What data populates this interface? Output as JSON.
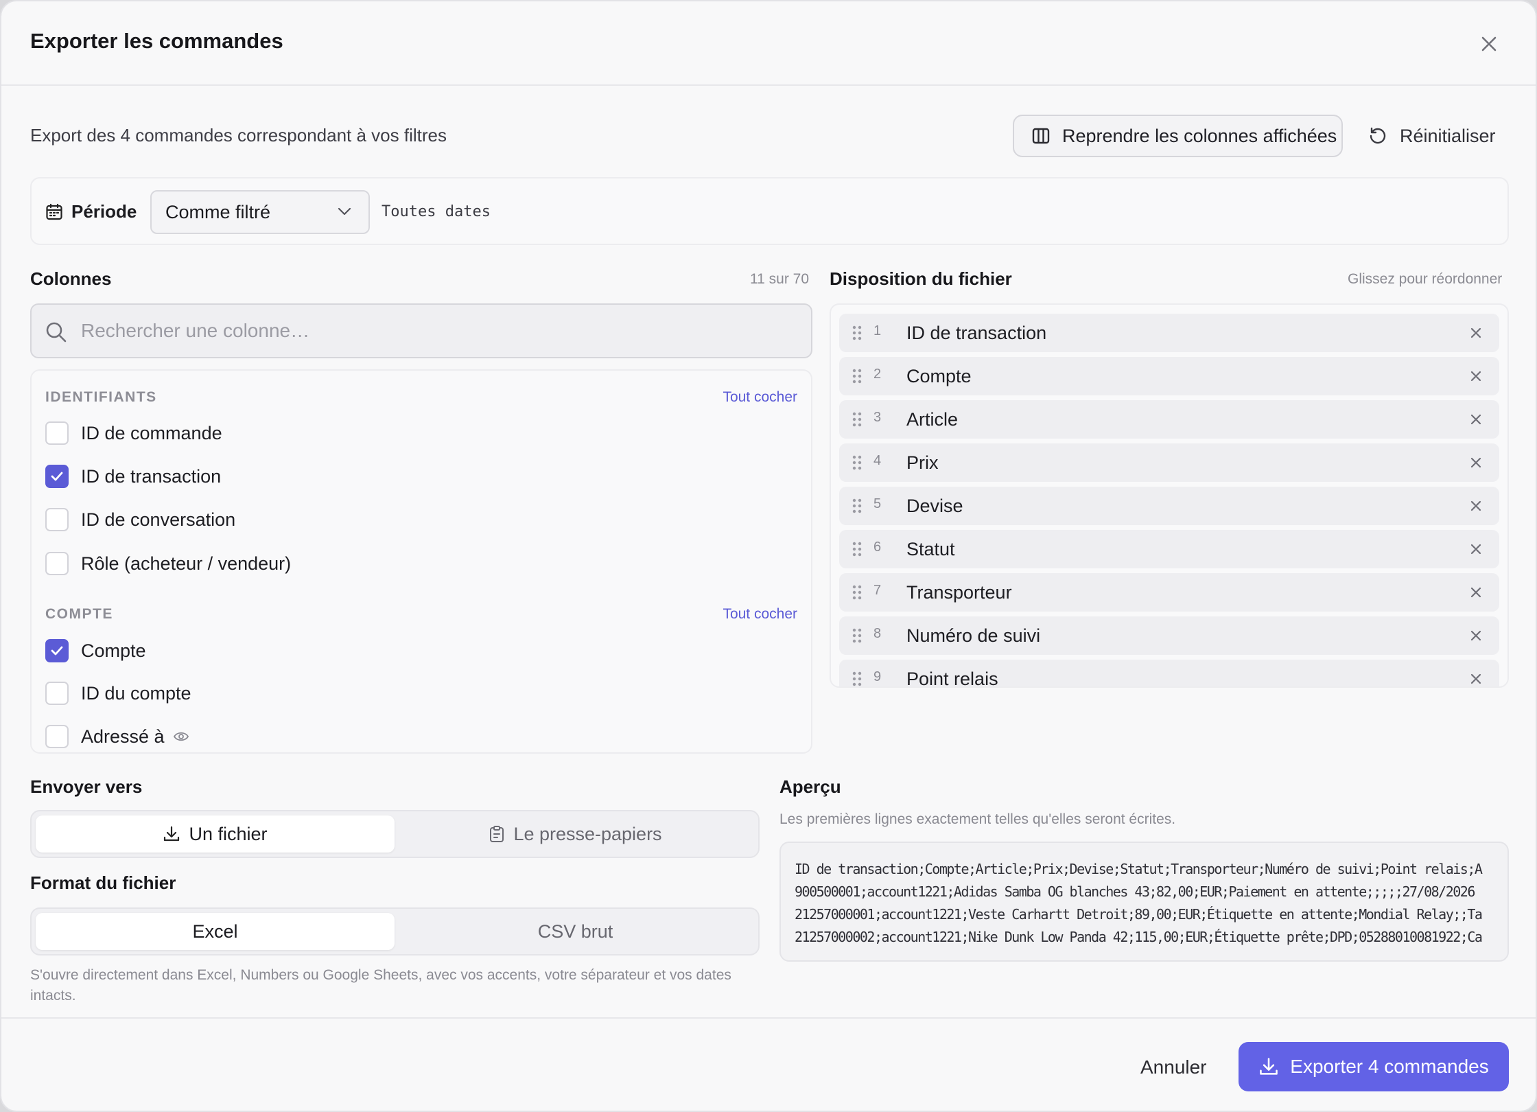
{
  "dialog": {
    "title": "Exporter les commandes",
    "subtitle": "Export des 4 commandes correspondant à vos filtres",
    "reuse_columns_label": "Reprendre les colonnes affichées",
    "reset_label": "Réinitialiser"
  },
  "period": {
    "label": "Période",
    "selected": "Comme filtré",
    "note": "Toutes dates"
  },
  "columns": {
    "title": "Colonnes",
    "count": "11 sur 70",
    "search_placeholder": "Rechercher une colonne…",
    "groups": [
      {
        "name": "IDENTIFIANTS",
        "select_all": "Tout cocher",
        "items": [
          {
            "label": "ID de commande",
            "checked": false
          },
          {
            "label": "ID de transaction",
            "checked": true
          },
          {
            "label": "ID de conversation",
            "checked": false
          },
          {
            "label": "Rôle (acheteur / vendeur)",
            "checked": false
          }
        ]
      },
      {
        "name": "COMPTE",
        "select_all": "Tout cocher",
        "items": [
          {
            "label": "Compte",
            "checked": true
          },
          {
            "label": "ID du compte",
            "checked": false
          },
          {
            "label": "Adressé à",
            "checked": false
          }
        ]
      }
    ]
  },
  "layout": {
    "title": "Disposition du fichier",
    "hint": "Glissez pour réordonner",
    "rows": [
      {
        "num": "1",
        "label": "ID de transaction"
      },
      {
        "num": "2",
        "label": "Compte"
      },
      {
        "num": "3",
        "label": "Article"
      },
      {
        "num": "4",
        "label": "Prix"
      },
      {
        "num": "5",
        "label": "Devise"
      },
      {
        "num": "6",
        "label": "Statut"
      },
      {
        "num": "7",
        "label": "Transporteur"
      },
      {
        "num": "8",
        "label": "Numéro de suivi"
      },
      {
        "num": "9",
        "label": "Point relais"
      }
    ]
  },
  "send": {
    "title": "Envoyer vers",
    "options": [
      "Un fichier",
      "Le presse-papiers"
    ],
    "selected": "Un fichier"
  },
  "format": {
    "title": "Format du fichier",
    "options": [
      "Excel",
      "CSV brut"
    ],
    "selected": "Excel",
    "hint": "S'ouvre directement dans Excel, Numbers ou Google Sheets, avec vos accents, votre séparateur et vos dates intacts."
  },
  "preview": {
    "title": "Aperçu",
    "subtitle": "Les premières lignes exactement telles qu'elles seront écrites.",
    "lines": [
      "ID de transaction;Compte;Article;Prix;Devise;Statut;Transporteur;Numéro de suivi;Point relais;A",
      "900500001;account1221;Adidas Samba OG blanches 43;82,00;EUR;Paiement en attente;;;;;27/08/2026",
      "21257000001;account1221;Veste Carhartt Detroit;89,00;EUR;Étiquette en attente;Mondial Relay;;Ta",
      "21257000002;account1221;Nike Dunk Low Panda 42;115,00;EUR;Étiquette prête;DPD;05288010081922;Ca"
    ]
  },
  "footer": {
    "cancel_label": "Annuler",
    "export_label": "Exporter 4 commandes"
  },
  "colors": {
    "accent": "#5b5bd6",
    "primary_button": "#6262e6"
  }
}
